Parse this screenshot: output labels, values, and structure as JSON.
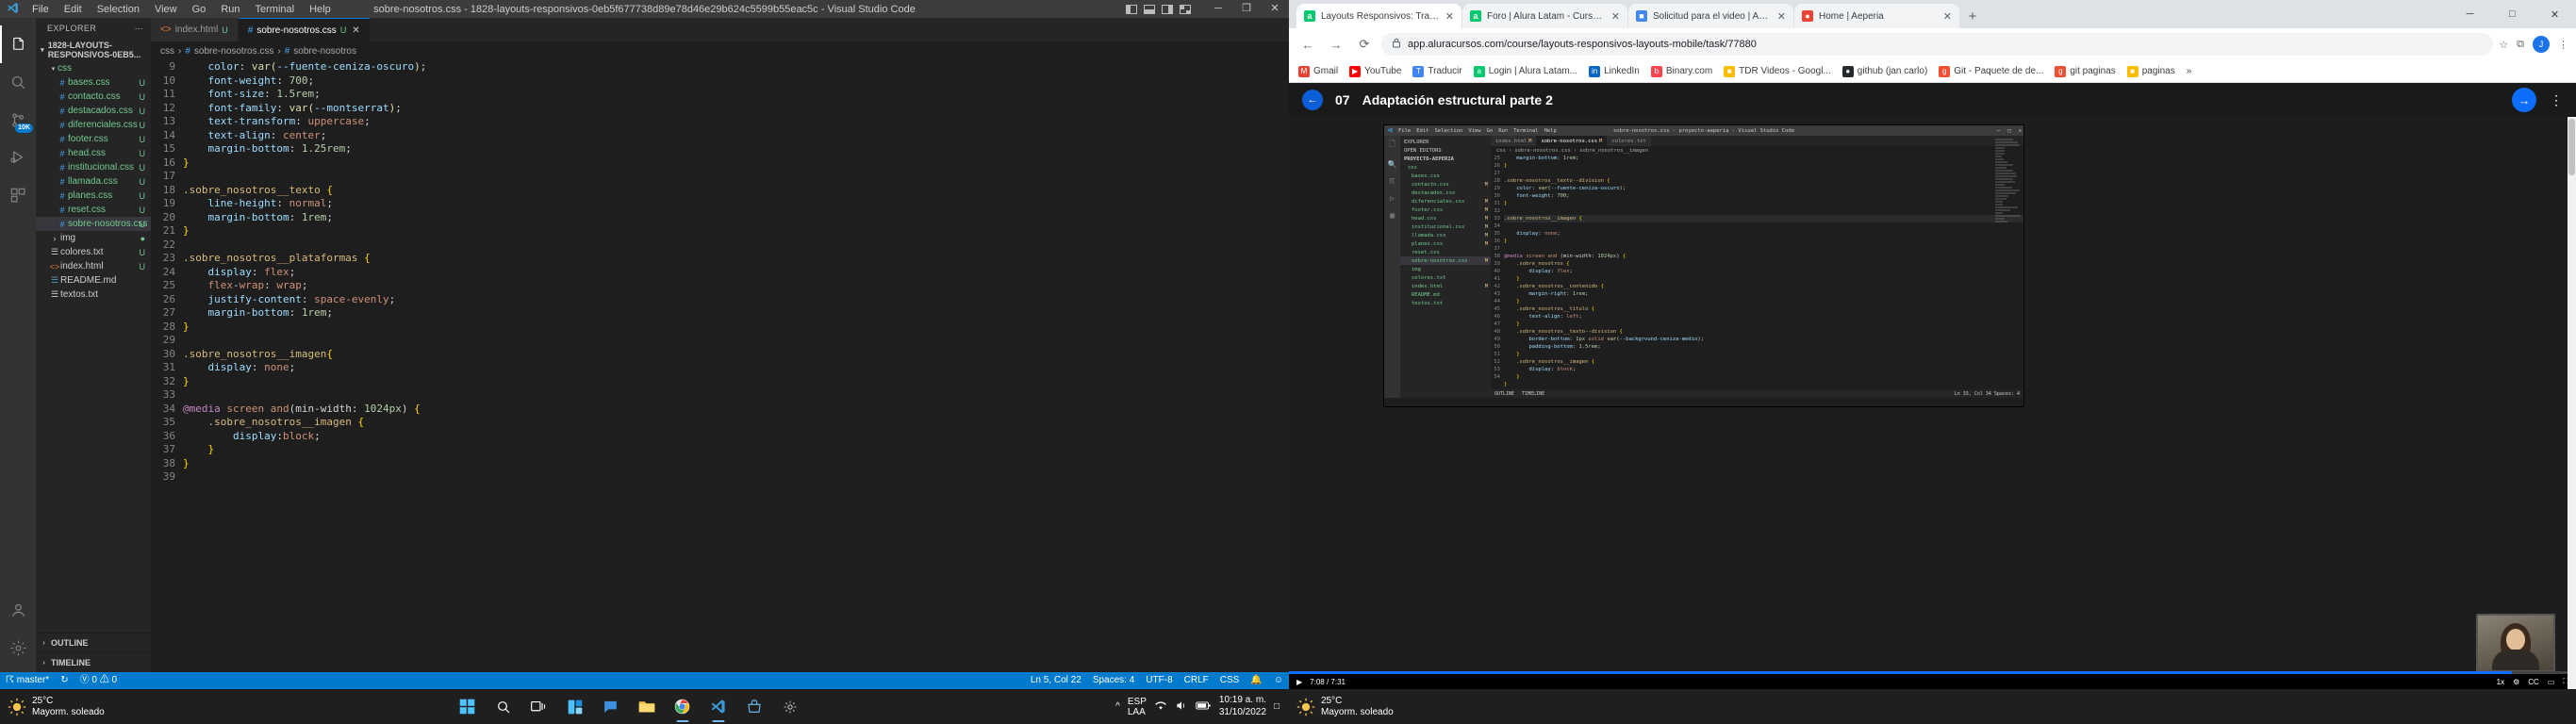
{
  "vscode": {
    "title": "sobre-nosotros.css - 1828-layouts-responsivos-0eb5f677738d89e78d46e29b624c5599b55eac5c - Visual Studio Code",
    "menu": [
      "File",
      "Edit",
      "Selection",
      "View",
      "Go",
      "Run",
      "Terminal",
      "Help"
    ],
    "window_controls": {
      "minimize": "─",
      "restore": "❐",
      "close": "✕"
    },
    "explorer": {
      "header": "EXPLORER",
      "more": "⋯",
      "root": "1828-LAYOUTS-RESPONSIVOS-0EB5...",
      "folder": "css",
      "files": [
        {
          "name": "bases.css",
          "icon": "#",
          "mark": "U"
        },
        {
          "name": "contacto.css",
          "icon": "#",
          "mark": "U"
        },
        {
          "name": "destacados.css",
          "icon": "#",
          "mark": "U"
        },
        {
          "name": "diferenciales.css",
          "icon": "#",
          "mark": "U"
        },
        {
          "name": "footer.css",
          "icon": "#",
          "mark": "U"
        },
        {
          "name": "head.css",
          "icon": "#",
          "mark": "U"
        },
        {
          "name": "institucional.css",
          "icon": "#",
          "mark": "U"
        },
        {
          "name": "llamada.css",
          "icon": "#",
          "mark": "U"
        },
        {
          "name": "planes.css",
          "icon": "#",
          "mark": "U"
        },
        {
          "name": "reset.css",
          "icon": "#",
          "mark": "U"
        },
        {
          "name": "sobre-nosotros.css",
          "icon": "#",
          "mark": "U",
          "selected": true
        }
      ],
      "others": [
        {
          "name": "img",
          "icon": "›",
          "mark": "●"
        },
        {
          "name": "colores.txt",
          "icon": "☰",
          "mark": "U"
        },
        {
          "name": "index.html",
          "icon": "<>",
          "mark": "U"
        },
        {
          "name": "README.md",
          "icon": "☰",
          "mark": ""
        },
        {
          "name": "textos.txt",
          "icon": "☰",
          "mark": ""
        }
      ],
      "sections": [
        "OUTLINE",
        "TIMELINE"
      ]
    },
    "tabs": [
      {
        "label": "index.html",
        "badge": "U",
        "icon": "<>",
        "active": false
      },
      {
        "label": "sobre-nosotros.css",
        "badge": "U",
        "icon": "#",
        "active": true,
        "close": "✕"
      }
    ],
    "breadcrumb": [
      "css",
      "sobre-nosotros.css",
      "sobre-nosotros"
    ],
    "code_lines": [
      {
        "n": 9,
        "text": "    color: var(--fuente-ceniza-oscuro);"
      },
      {
        "n": 10,
        "text": "    font-weight: 700;"
      },
      {
        "n": 11,
        "text": "    font-size: 1.5rem;"
      },
      {
        "n": 12,
        "text": "    font-family: var(--montserrat);"
      },
      {
        "n": 13,
        "text": "    text-transform: uppercase;"
      },
      {
        "n": 14,
        "text": "    text-align: center;"
      },
      {
        "n": 15,
        "text": "    margin-bottom: 1.25rem;"
      },
      {
        "n": 16,
        "text": "}"
      },
      {
        "n": 17,
        "text": ""
      },
      {
        "n": 18,
        "text": ".sobre_nosotros__texto {"
      },
      {
        "n": 19,
        "text": "    line-height: normal;"
      },
      {
        "n": 20,
        "text": "    margin-bottom: 1rem;"
      },
      {
        "n": 21,
        "text": "}"
      },
      {
        "n": 22,
        "text": ""
      },
      {
        "n": 23,
        "text": ".sobre_nosotros__plataformas {"
      },
      {
        "n": 24,
        "text": "    display: flex;"
      },
      {
        "n": 25,
        "text": "    flex-wrap: wrap;"
      },
      {
        "n": 26,
        "text": "    justify-content: space-evenly;"
      },
      {
        "n": 27,
        "text": "    margin-bottom: 1rem;"
      },
      {
        "n": 28,
        "text": "}"
      },
      {
        "n": 29,
        "text": ""
      },
      {
        "n": 30,
        "text": ".sobre_nosotros__imagen{"
      },
      {
        "n": 31,
        "text": "    display: none;"
      },
      {
        "n": 32,
        "text": "}"
      },
      {
        "n": 33,
        "text": ""
      },
      {
        "n": 34,
        "text": "@media screen and(min-width: 1024px) {"
      },
      {
        "n": 35,
        "text": "    .sobre_nosotros__imagen {"
      },
      {
        "n": 36,
        "text": "        display:block;"
      },
      {
        "n": 37,
        "text": "    }"
      },
      {
        "n": 38,
        "text": "}"
      },
      {
        "n": 39,
        "text": ""
      }
    ],
    "statusbar": {
      "branch": "master*",
      "sync": "↻",
      "errors": "0",
      "warnings": "0",
      "position": "Ln 5, Col 22",
      "spaces": "Spaces: 4",
      "encoding": "UTF-8",
      "eol": "CRLF",
      "language": "CSS",
      "bell": "🔔",
      "smiley": "☺"
    }
  },
  "chrome": {
    "tabs": [
      {
        "title": "Layouts Responsivos: Trabajand",
        "favicon": "a",
        "favcolor": "#00c86f",
        "active": true
      },
      {
        "title": "Foro | Alura Latam - Cursos onli",
        "favicon": "a",
        "favcolor": "#00c86f",
        "active": false
      },
      {
        "title": "Solicitud para el video | Adaptac",
        "favicon": "■",
        "favcolor": "#4285f4",
        "active": false
      },
      {
        "title": "Home | Aeperia",
        "favicon": "●",
        "favcolor": "#ea4335",
        "active": false
      }
    ],
    "new_tab": "+",
    "window_controls": {
      "minimize": "─",
      "maximize": "□",
      "close": "✕"
    },
    "nav": {
      "back": "←",
      "forward": "→",
      "reload": "⟳"
    },
    "omnibox": {
      "lock": "🔒",
      "url": "app.aluracursos.com/course/layouts-responsivos-layouts-mobile/task/77880",
      "star": "☆",
      "extensions": "⧉",
      "menu": "⋮",
      "avatar": "J"
    },
    "bookmarks": [
      {
        "label": "Gmail",
        "color": "#ea4335",
        "icon": "M"
      },
      {
        "label": "YouTube",
        "color": "#ff0000",
        "icon": "▶"
      },
      {
        "label": "Traducir",
        "color": "#4285f4",
        "icon": "T"
      },
      {
        "label": "Login | Alura Latam...",
        "color": "#00c86f",
        "icon": "a"
      },
      {
        "label": "LinkedIn",
        "color": "#0a66c2",
        "icon": "in"
      },
      {
        "label": "Binary.com",
        "color": "#ff444f",
        "icon": "b"
      },
      {
        "label": "TDR Videos - Googl...",
        "color": "#fbbc04",
        "icon": "■"
      },
      {
        "label": "github (jan carlo)",
        "color": "#24292e",
        "icon": "●"
      },
      {
        "label": "Git - Paquete de de...",
        "color": "#f05032",
        "icon": "g"
      },
      {
        "label": "git paginas",
        "color": "#f05032",
        "icon": "g"
      },
      {
        "label": "paginas",
        "color": "#fbbc04",
        "icon": "■"
      },
      {
        "label": "»",
        "color": "#ffffff",
        "icon": ""
      }
    ],
    "course": {
      "lesson_number": "07",
      "lesson_title": "Adaptación estructural parte 2",
      "back_icon": "←",
      "next_icon": "→",
      "menu_icon": "⋮"
    },
    "video": {
      "play_icon": "▶",
      "time_current": "7:08",
      "time_total": "7:31",
      "speed": "1x",
      "settings_icon": "⚙",
      "captions_icon": "CC",
      "theater_icon": "▭",
      "fullscreen_icon": "⛶",
      "inner": {
        "title": "sobre-nosotros.css - proyecto-aeperia - Visual Studio Code",
        "menu": [
          "File",
          "Edit",
          "Selection",
          "View",
          "Go",
          "Run",
          "Terminal",
          "Help"
        ],
        "explorer_header": "EXPLORER",
        "open_editors": "OPEN EDITORS",
        "project": "PROYECTO-AEPERIA",
        "folder": "css",
        "files": [
          {
            "name": "bases.css",
            "mark": ""
          },
          {
            "name": "contacto.css",
            "mark": "M"
          },
          {
            "name": "destacados.css",
            "mark": ""
          },
          {
            "name": "diferenciales.css",
            "mark": "M"
          },
          {
            "name": "footer.css",
            "mark": "M"
          },
          {
            "name": "head.css",
            "mark": "M"
          },
          {
            "name": "institucional.css",
            "mark": "M"
          },
          {
            "name": "llamada.css",
            "mark": "M"
          },
          {
            "name": "planes.css",
            "mark": "M"
          },
          {
            "name": "reset.css",
            "mark": ""
          },
          {
            "name": "sobre-nosotros.css",
            "mark": "M",
            "selected": true
          },
          {
            "name": "img",
            "mark": ""
          },
          {
            "name": "colores.txt",
            "mark": ""
          },
          {
            "name": "index.html",
            "mark": "M"
          },
          {
            "name": "README.md",
            "mark": ""
          },
          {
            "name": "textos.txt",
            "mark": ""
          }
        ],
        "tabs": [
          {
            "label": "index.html",
            "badge": "M",
            "active": false
          },
          {
            "label": "sobre-nosotros.css",
            "badge": "M",
            "active": true
          },
          {
            "label": "colores.txt",
            "badge": "",
            "active": false
          }
        ],
        "breadcrumb": [
          "css",
          "sobre-nosotros.css",
          "sobre_nosotros__imagen"
        ],
        "code_lines": [
          {
            "n": 25,
            "text": "    margin-bottom: 1rem;"
          },
          {
            "n": 26,
            "text": "}"
          },
          {
            "n": 27,
            "text": ""
          },
          {
            "n": 28,
            "text": ".sobre-nosotros__texto--division {"
          },
          {
            "n": 29,
            "text": "    color: var(--fuente-ceniza-oscuro);"
          },
          {
            "n": 30,
            "text": "    font-weight: 700;"
          },
          {
            "n": 31,
            "text": "}"
          },
          {
            "n": 32,
            "text": ""
          },
          {
            "n": 33,
            "text": ".sobre_nosotros__imagen {",
            "hl": true
          },
          {
            "n": 34,
            "text": "    display: none;"
          },
          {
            "n": 35,
            "text": "}"
          },
          {
            "n": 36,
            "text": ""
          },
          {
            "n": 37,
            "text": "@media screen and (min-width: 1024px) {"
          },
          {
            "n": 38,
            "text": "    .sobre_nosotros {"
          },
          {
            "n": 39,
            "text": "        display: flex;"
          },
          {
            "n": 40,
            "text": "    }"
          },
          {
            "n": 41,
            "text": "    .sobre_nosotros__contenido {"
          },
          {
            "n": 42,
            "text": "        margin-right: 1rem;"
          },
          {
            "n": 43,
            "text": "    }"
          },
          {
            "n": 44,
            "text": "    .sobre_nosotros__titulo {"
          },
          {
            "n": 45,
            "text": "        text-align: left;"
          },
          {
            "n": 46,
            "text": "    }"
          },
          {
            "n": 47,
            "text": "    .sobre_nosotros__texto--division {"
          },
          {
            "n": 48,
            "text": "        border-bottom: 1px solid var(--background-ceniza-medio);"
          },
          {
            "n": 49,
            "text": "        padding-bottom: 1.5rem;"
          },
          {
            "n": 50,
            "text": "    }"
          },
          {
            "n": 51,
            "text": "    .sobre_nosotros__imagen {"
          },
          {
            "n": 52,
            "text": "        display: block;"
          },
          {
            "n": 53,
            "text": "    }"
          },
          {
            "n": 54,
            "text": "}"
          }
        ],
        "outline": "OUTLINE",
        "timeline": "TIMELINE",
        "status": "Ln 33, Col 34   Spaces: 4"
      }
    }
  },
  "taskbar_left": {
    "weather_temp": "25°C",
    "weather_desc": "Mayorm. soleado",
    "icons": [
      "windows",
      "search",
      "taskview",
      "widgets",
      "chat",
      "explorer",
      "chrome",
      "vscode",
      "store",
      "settings"
    ],
    "tray": {
      "lang": "ESP",
      "lang2": "LAA",
      "wifi": "◰",
      "volume": "▶",
      "battery": "▮",
      "time": "10:19 a. m.",
      "date": "31/10/2022",
      "notif": "□"
    }
  },
  "taskbar_right": {
    "weather_temp": "25°C",
    "weather_desc": "Mayorm. soleado"
  }
}
